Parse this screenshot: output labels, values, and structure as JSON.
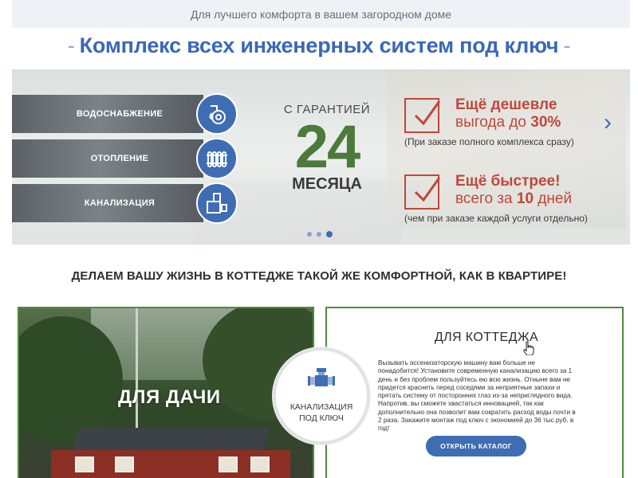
{
  "top_bar": {
    "tagline": "Для лучшего комфорта в вашем загородном доме"
  },
  "headline": {
    "dash_left": "-",
    "text": "Комплекс всех инженерных систем под ключ",
    "dash_right": "-"
  },
  "hero": {
    "services": [
      {
        "label": "ВОДОСНАБЖЕНИЕ",
        "icon": "water-tap-icon"
      },
      {
        "label": "ОТОПЛЕНИЕ",
        "icon": "radiator-icon"
      },
      {
        "label": "КАНАЛИЗАЦИЯ",
        "icon": "pipe-icon"
      }
    ],
    "guarantee": {
      "top": "С ГАРАНТИЕЙ",
      "number": "24",
      "bottom": "МЕСЯЦА"
    },
    "offers": [
      {
        "title": "Ещё дешевле",
        "sub_text": "выгода до ",
        "sub_value": "30%",
        "note": "(При заказе полного комплекса сразу)"
      },
      {
        "title": "Ещё быстрее!",
        "sub_text": "всего за ",
        "sub_value": "10",
        "sub_suffix": " дней",
        "note": "(чем при заказе каждой услуги отдельно)"
      }
    ],
    "arrow_left": "‹",
    "arrow_right": "›",
    "slides_total": 3,
    "active_slide": 3
  },
  "section": {
    "title": "ДЕЛАЕМ ВАШУ ЖИЗНЬ В КОТТЕДЖЕ ТАКОЙ ЖЕ КОМФОРТНОЙ, КАК В КВАРТИРЕ!"
  },
  "dacha": {
    "label": "ДЛЯ ДАЧИ"
  },
  "circle": {
    "line1": "КАНАЛИЗАЦИЯ",
    "line2": "ПОД КЛЮЧ"
  },
  "cottage": {
    "title": "ДЛЯ КОТТЕДЖА",
    "text": "Вызывать ассенизаторскую машину вам больше не понадобится! Установите современную канализацию всего за 1 день и без проблем пользуйтесь ею всю жизнь. Отныне вам не придется краснеть перед соседями за неприятные запахи и прятать систему от посторонних глаз из-за неприглядного вида. Напротив, вы сможете хвастаться инновацией, так как дополнительно она позволит вам сократить расход воды почти в 2 раза. Закажите монтаж под ключ с экономией до 36 тыс.руб. в год!",
    "button": "ОТКРЫТЬ КАТАЛОГ"
  },
  "colors": {
    "blue": "#3e6db4",
    "green": "#4b7a3b",
    "red": "#c0473a",
    "border_green": "#4f8a3c"
  }
}
